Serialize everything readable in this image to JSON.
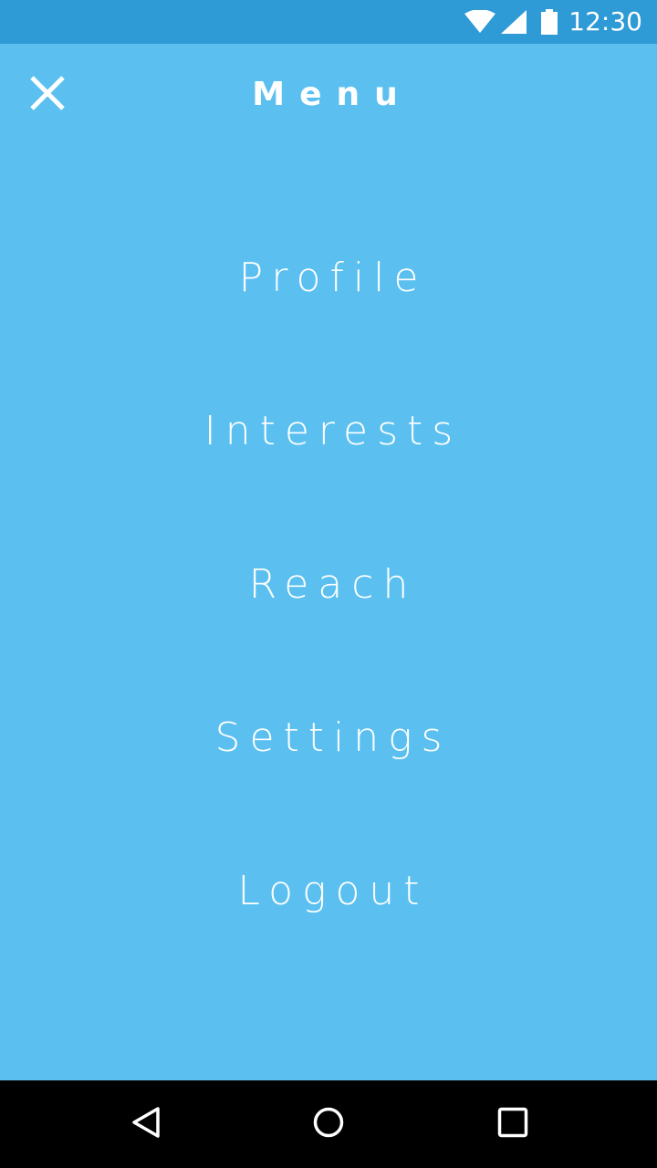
{
  "status_bar": {
    "time": "12:30",
    "icons": [
      "wifi-icon",
      "signal-icon",
      "battery-icon"
    ]
  },
  "header": {
    "title": "Menu",
    "close_icon": "close-icon"
  },
  "menu": {
    "items": [
      {
        "label": "Profile"
      },
      {
        "label": "Interests"
      },
      {
        "label": "Reach"
      },
      {
        "label": "Settings"
      },
      {
        "label": "Logout"
      }
    ]
  },
  "nav_bar": {
    "buttons": [
      "back-icon",
      "home-icon",
      "recents-icon"
    ]
  },
  "colors": {
    "background": "#5bc0ef",
    "status_bar": "#2e9ad6",
    "text": "#ffffff",
    "nav_bar": "#000000"
  }
}
